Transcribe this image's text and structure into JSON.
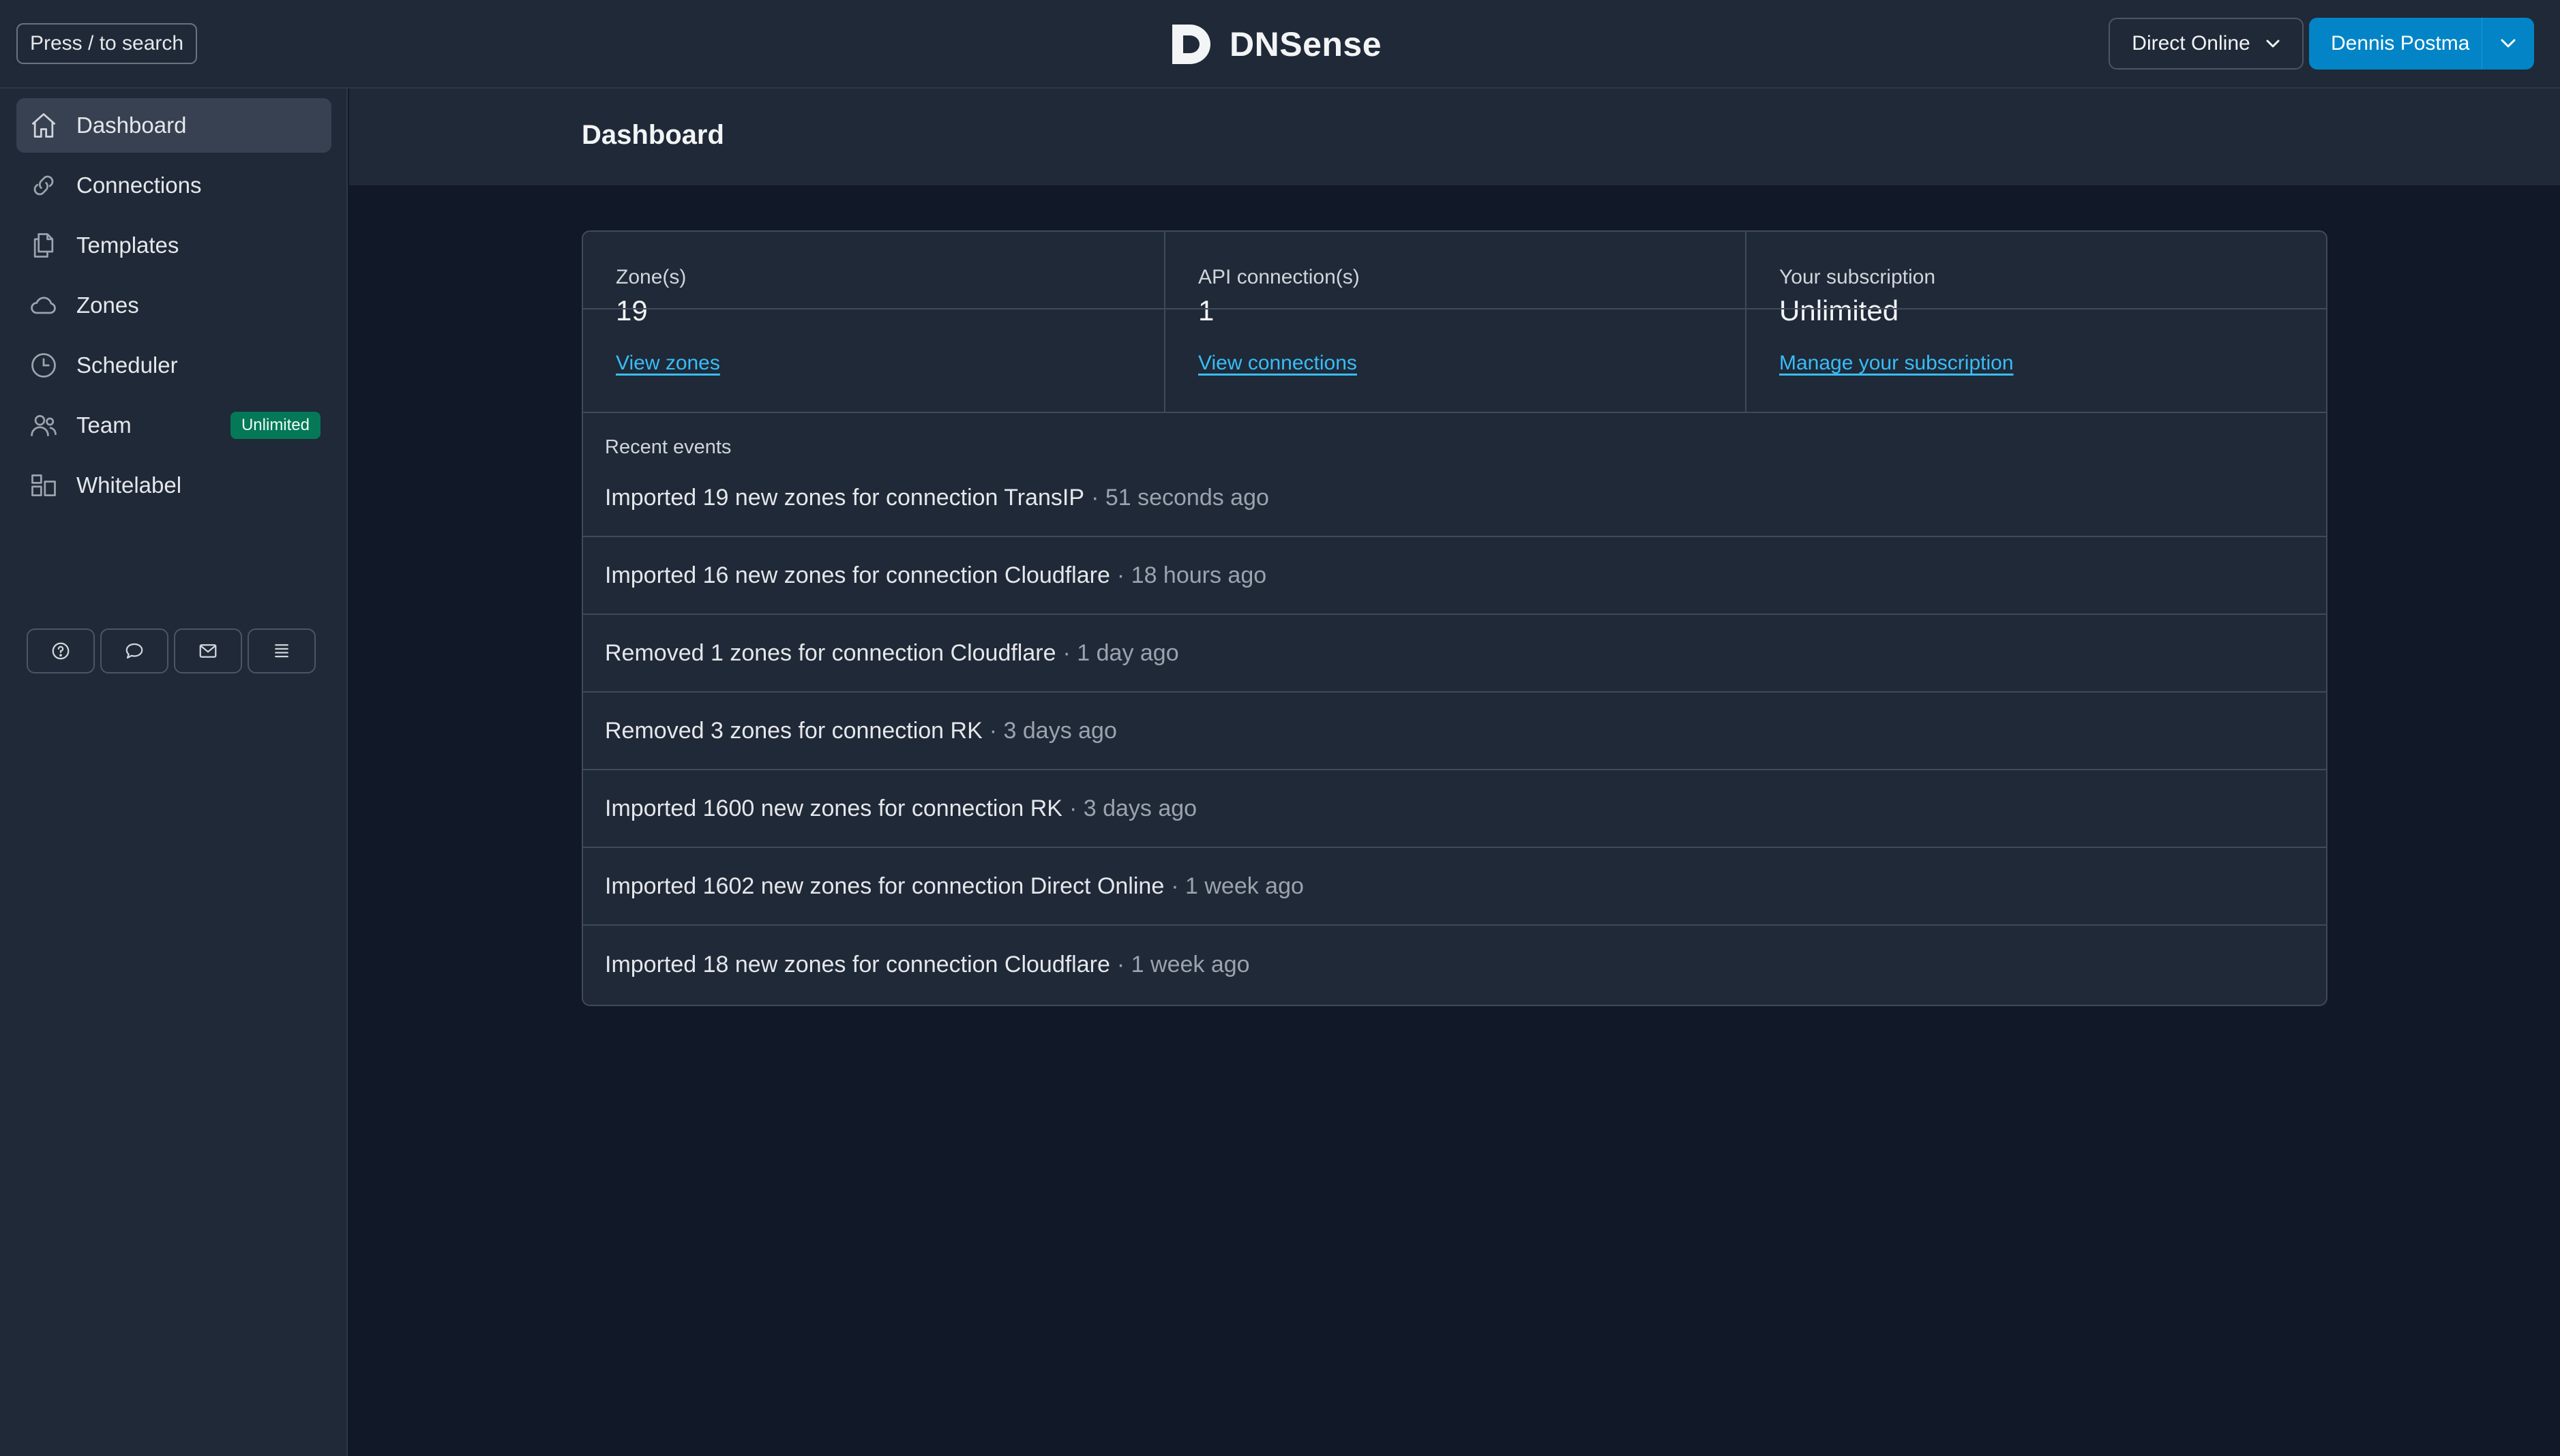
{
  "header": {
    "search_label": "Press / to search",
    "app_name": "DNSense",
    "org_selector": "Direct Online",
    "user_menu": "Dennis Postma"
  },
  "sidebar": {
    "items": [
      {
        "label": "Dashboard",
        "icon": "home-icon"
      },
      {
        "label": "Connections",
        "icon": "link-icon"
      },
      {
        "label": "Templates",
        "icon": "documents-icon"
      },
      {
        "label": "Zones",
        "icon": "cloud-icon"
      },
      {
        "label": "Scheduler",
        "icon": "clock-icon"
      },
      {
        "label": "Team",
        "icon": "users-icon",
        "badge": "Unlimited"
      },
      {
        "label": "Whitelabel",
        "icon": "layout-icon"
      }
    ],
    "tools": [
      "help-icon",
      "chat-icon",
      "mail-icon",
      "list-icon"
    ]
  },
  "main": {
    "title": "Dashboard",
    "stats": [
      {
        "label": "Zone(s)",
        "value": "19",
        "link": "View zones"
      },
      {
        "label": "API connection(s)",
        "value": "1",
        "link": "View connections"
      },
      {
        "label": "Your subscription",
        "value": "Unlimited",
        "link": "Manage your subscription"
      }
    ],
    "events_label": "Recent events",
    "events": [
      {
        "text": "Imported 19 new zones for connection TransIP",
        "time": "· 51 seconds ago"
      },
      {
        "text": "Imported 16 new zones for connection Cloudflare",
        "time": "· 18 hours ago"
      },
      {
        "text": "Removed 1 zones for connection Cloudflare",
        "time": "· 1 day ago"
      },
      {
        "text": "Removed 3 zones for connection RK",
        "time": "· 3 days ago"
      },
      {
        "text": "Imported 1600 new zones for connection RK",
        "time": "· 3 days ago"
      },
      {
        "text": "Imported 1602 new zones for connection Direct Online",
        "time": "· 1 week ago"
      },
      {
        "text": "Imported 18 new zones for connection Cloudflare",
        "time": "· 1 week ago"
      }
    ]
  },
  "colors": {
    "background": "#111827",
    "panel": "#1f2937",
    "accent": "#0284c7",
    "link": "#38bdf8",
    "badge": "#047857"
  }
}
